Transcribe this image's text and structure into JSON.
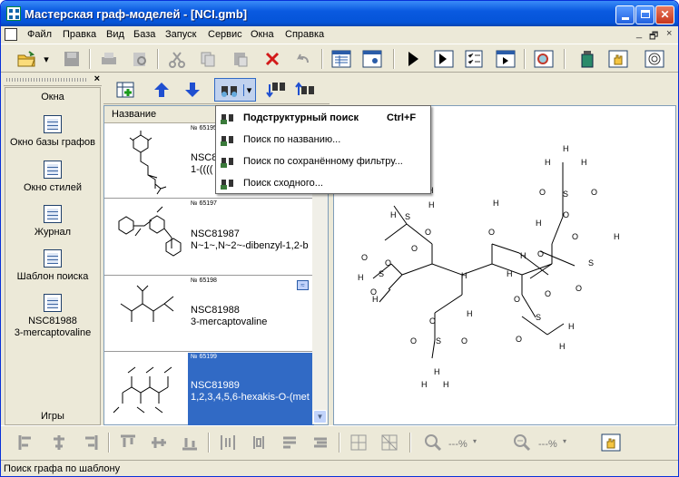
{
  "window": {
    "title": "Мастерская граф-моделей - [NCI.gmb]"
  },
  "titlebar_buttons": [
    "minimize",
    "maximize",
    "close"
  ],
  "menu": {
    "items": [
      "Файл",
      "Правка",
      "Вид",
      "База",
      "Запуск",
      "Сервис",
      "Окна",
      "Справка"
    ],
    "mdi_controls": [
      "_",
      "🗗",
      "×"
    ]
  },
  "left_panel": {
    "title": "Окна",
    "items": [
      {
        "label": "Окно базы графов",
        "icon": "graph-db-window-icon"
      },
      {
        "label": "Окно стилей",
        "icon": "styles-window-icon"
      },
      {
        "label": "Журнал",
        "icon": "journal-icon"
      },
      {
        "label": "Шаблон поиска",
        "icon": "search-template-icon"
      },
      {
        "label": "NSC81988\n3-mercaptovaline",
        "icon": "graph-window-icon"
      }
    ],
    "footer": "Игры",
    "close": "×"
  },
  "list": {
    "column_header": "Название",
    "rows": [
      {
        "id": "№ 65195",
        "nsc": "NSC8",
        "desc": "1-(((("
      },
      {
        "id": "№ 65197",
        "nsc": "NSC81987",
        "desc": "N~1~,N~2~-dibenzyl-1,2-b"
      },
      {
        "id": "№ 65198",
        "nsc": "NSC81988",
        "desc": "3-mercaptovaline"
      },
      {
        "id": "№ 65199",
        "nsc": "NSC81989",
        "desc": "1,2,3,4,5,6-hexakis-O-(met",
        "selected": true
      }
    ]
  },
  "search_menu": {
    "items": [
      {
        "label": "Подструктурный поиск",
        "shortcut": "Ctrl+F",
        "bold": true
      },
      {
        "label": "Поиск по названию..."
      },
      {
        "label": "Поиск по сохранённому фильтру..."
      },
      {
        "label": "Поиск сходного..."
      }
    ]
  },
  "toolbar3": {
    "zoom1": "---%",
    "zoom2": "---%"
  },
  "status": {
    "text": "Поиск графа по шаблону"
  },
  "colors": {
    "titlebar": "#0a5ae0",
    "selection": "#316ac5",
    "chrome": "#ece9d8"
  }
}
